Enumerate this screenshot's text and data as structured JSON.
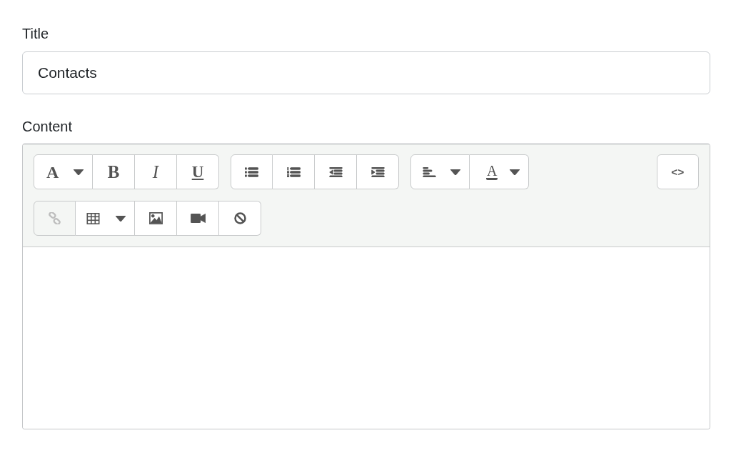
{
  "title_field": {
    "label": "Title",
    "value": "Contacts"
  },
  "content_editor": {
    "label": "Content",
    "toolbar": {
      "rows": [
        {
          "groups": [
            {
              "buttons": [
                {
                  "kind": "font",
                  "glyph": "A",
                  "dropdown": true,
                  "disabled": false
                },
                {
                  "kind": "bold",
                  "glyph": "B",
                  "dropdown": false,
                  "disabled": false
                },
                {
                  "kind": "italic",
                  "glyph": "I",
                  "dropdown": false,
                  "disabled": false
                },
                {
                  "kind": "underline",
                  "glyph": "U",
                  "dropdown": false,
                  "disabled": false
                }
              ]
            },
            {
              "buttons": [
                {
                  "kind": "bullets",
                  "dropdown": false,
                  "disabled": false
                },
                {
                  "kind": "numbering",
                  "dropdown": false,
                  "disabled": false
                },
                {
                  "kind": "outdent",
                  "dropdown": false,
                  "disabled": false
                },
                {
                  "kind": "indent",
                  "dropdown": false,
                  "disabled": false
                }
              ]
            },
            {
              "buttons": [
                {
                  "kind": "align",
                  "dropdown": true,
                  "disabled": false
                },
                {
                  "kind": "color",
                  "glyph": "A",
                  "dropdown": true,
                  "disabled": false
                }
              ]
            }
          ],
          "trailing_groups": [
            {
              "buttons": [
                {
                  "kind": "html",
                  "glyph": "<>",
                  "dropdown": false,
                  "disabled": false
                }
              ]
            }
          ]
        },
        {
          "groups": [
            {
              "buttons": [
                {
                  "kind": "link",
                  "dropdown": false,
                  "disabled": true
                },
                {
                  "kind": "table",
                  "dropdown": true,
                  "disabled": false
                },
                {
                  "kind": "image",
                  "dropdown": false,
                  "disabled": false
                },
                {
                  "kind": "video",
                  "dropdown": false,
                  "disabled": false
                },
                {
                  "kind": "clear",
                  "dropdown": false,
                  "disabled": false
                }
              ]
            }
          ]
        }
      ]
    }
  }
}
